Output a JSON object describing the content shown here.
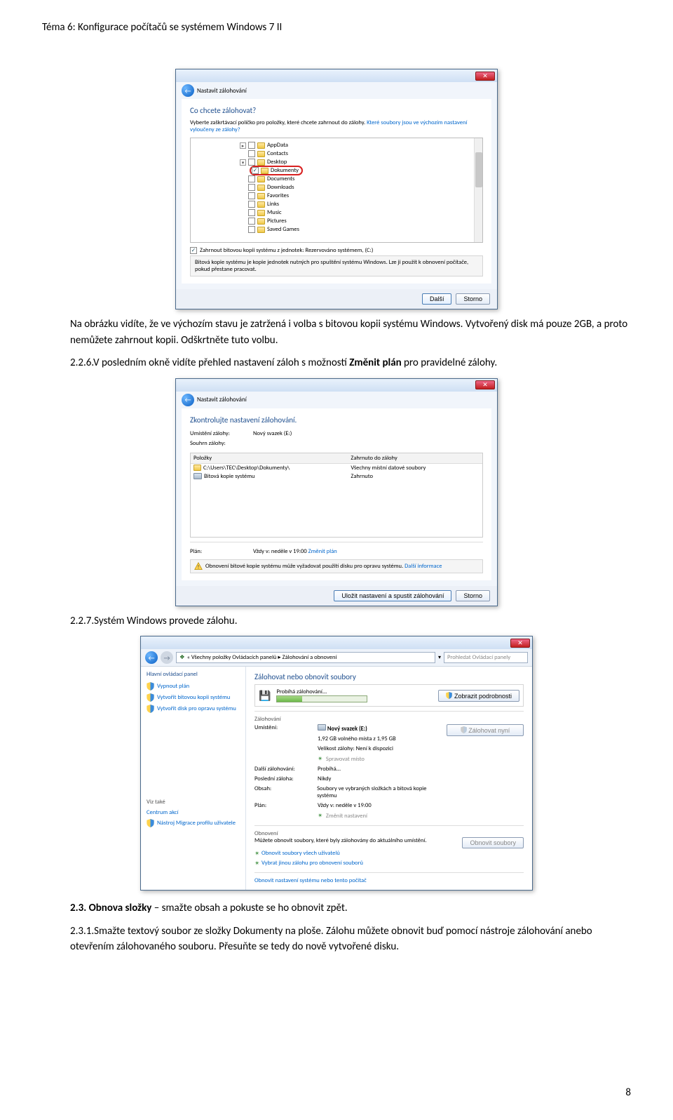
{
  "doc": {
    "header": "Téma 6: Konfigurace počítačů se systémem Windows 7 II",
    "para1": "Na obrázku vidíte, že ve výchozím stavu je zatržená i volba s bitovou kopii systému Windows. Vytvořený disk má pouze 2GB, a proto nemůžete zahrnout kopii. Odškrtněte tuto volbu.",
    "step226": "2.2.6.V posledním okně vidíte přehled nastavení záloh s možností ",
    "step226bold": "Změnit plán",
    "step226tail": " pro pravidelné zálohy.",
    "step227": "2.2.7.Systém Windows provede zálohu.",
    "heading23": "2.3. Obnova složky",
    "heading23tail": " – smažte obsah a pokuste se ho obnovit zpět.",
    "step231": "2.3.1.Smažte textový soubor ze složky Dokumenty na ploše. Zálohu můžete obnovit buď pomocí nástroje zálohování anebo otevřením zálohovaného souboru. Přesuňte se tedy do nově vytvořené disku.",
    "page_num": "8"
  },
  "dialog1": {
    "back_label": "Nastavit zálohování",
    "title": "Co chcete zálohovat?",
    "instruction": "Vyberte zaškrtávací políčko pro položky, které chcete zahrnout do zálohy. ",
    "link": "Které soubory jsou ve výchozím nastavení vyloučeny ze zálohy?",
    "folders": {
      "appdata": "AppData",
      "contacts": "Contacts",
      "desktop": "Desktop",
      "dokumenty": "Dokumenty",
      "documents": "Documents",
      "downloads": "Downloads",
      "favorites": "Favorites",
      "links": "Links",
      "music": "Music",
      "pictures": "Pictures",
      "savedgames": "Saved Games"
    },
    "include_image": "Zahrnout bitovou kopii systému z jednotek: Rezervováno systémem, (C:)",
    "image_desc": "Bitová kopie systému je kopie jednotek nutných pro spuštění systému Windows. Lze ji použít k obnovení počítače, pokud přestane pracovat.",
    "next": "Další",
    "cancel": "Storno"
  },
  "dialog2": {
    "back_label": "Nastavit zálohování",
    "title": "Zkontrolujte nastavení zálohování.",
    "loc_label": "Umístění zálohy:",
    "loc_val": "Nový svazek (E:)",
    "summary_label": "Souhrn zálohy:",
    "col1": "Položky",
    "col2": "Zahrnuto do zálohy",
    "row1_path": "C:\\Users\\TEC\\Desktop\\Dokumenty\\",
    "row1_val": "Všechny místní datové soubory",
    "row2_path": "Bitová kopie systému",
    "row2_val": "Zahrnuto",
    "plan_label": "Plán:",
    "plan_val": "Vždy v: neděle v 19:00 ",
    "plan_link": "Změnit plán",
    "warn": "Obnovení bitové kopie systému může vyžadovat použití disku pro opravu systému. ",
    "warn_link": "Další informace",
    "save": "Uložit nastavení a spustit zálohování",
    "cancel": "Storno"
  },
  "explorer": {
    "breadcrumb1": "Všechny položky Ovládacích panelů",
    "breadcrumb2": "Zálohování a obnovení",
    "search_ph": "Prohledat Ovládací panely",
    "left_head": "Hlavní ovládací panel",
    "left_links": {
      "disable": "Vypnout plán",
      "create_image": "Vytvořit bitovou kopii systému",
      "create_repair": "Vytvořit disk pro opravu systému"
    },
    "see_also": "Viz také",
    "see_action": "Centrum akcí",
    "see_migrate": "Nástroj Migrace profilu uživatele",
    "main_head": "Zálohovat nebo obnovit soubory",
    "running": "Probíhá zálohování...",
    "view_details": "Zobrazit podrobnosti",
    "section_backup": "Zálohování",
    "loc_label": "Umístění:",
    "loc_val": "Nový svazek (E:)",
    "backup_now": "Zálohovat nyní",
    "space": "1,92 GB volného místa z 1,95 GB",
    "size_label": "Velikost zálohy: Není k dispozici",
    "manage_space": "Spravovat místo",
    "next_label": "Další zálohování:",
    "next_val": "Probíhá...",
    "last_label": "Poslední záloha:",
    "last_val": "Nikdy",
    "content_label": "Obsah:",
    "content_val": "Soubory ve vybraných složkách a bitová kopie systému",
    "plan_label": "Plán:",
    "plan_val": "Vždy v: neděle v 19:00",
    "change": "Změnit nastavení",
    "section_restore": "Obnovení",
    "restore_desc": "Můžete obnovit soubory, které byly zálohovány do aktuálního umístění.",
    "restore_btn": "Obnovit soubory",
    "restore_all": "Obnovit soubory všech uživatelů",
    "restore_other": "Vybrat jinou zálohu pro obnovení souborů",
    "restore_sys": "Obnovit nastavení systému nebo tento počítač"
  }
}
